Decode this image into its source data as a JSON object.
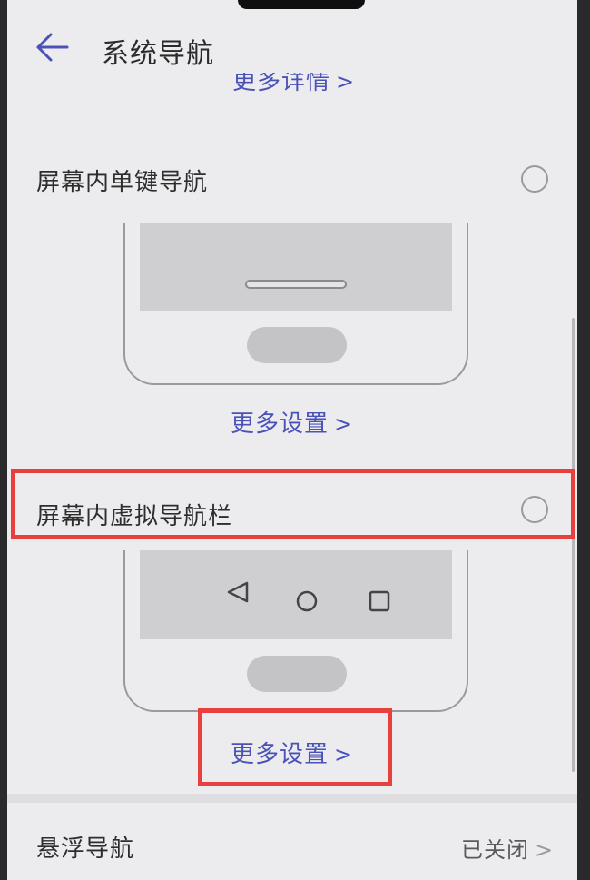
{
  "header": {
    "title": "系统导航"
  },
  "options": [
    {
      "label": "屏幕内单键导航",
      "more_link": "更多设置",
      "selected": false
    },
    {
      "label": "屏幕内虚拟导航栏",
      "more_link": "更多设置",
      "selected": false
    }
  ],
  "top_link": "更多详情",
  "floating_nav": {
    "label": "悬浮导航",
    "status": "已关闭"
  },
  "colors": {
    "accent": "#4a52b8",
    "highlight": "#e8403f",
    "background": "#ececee"
  }
}
